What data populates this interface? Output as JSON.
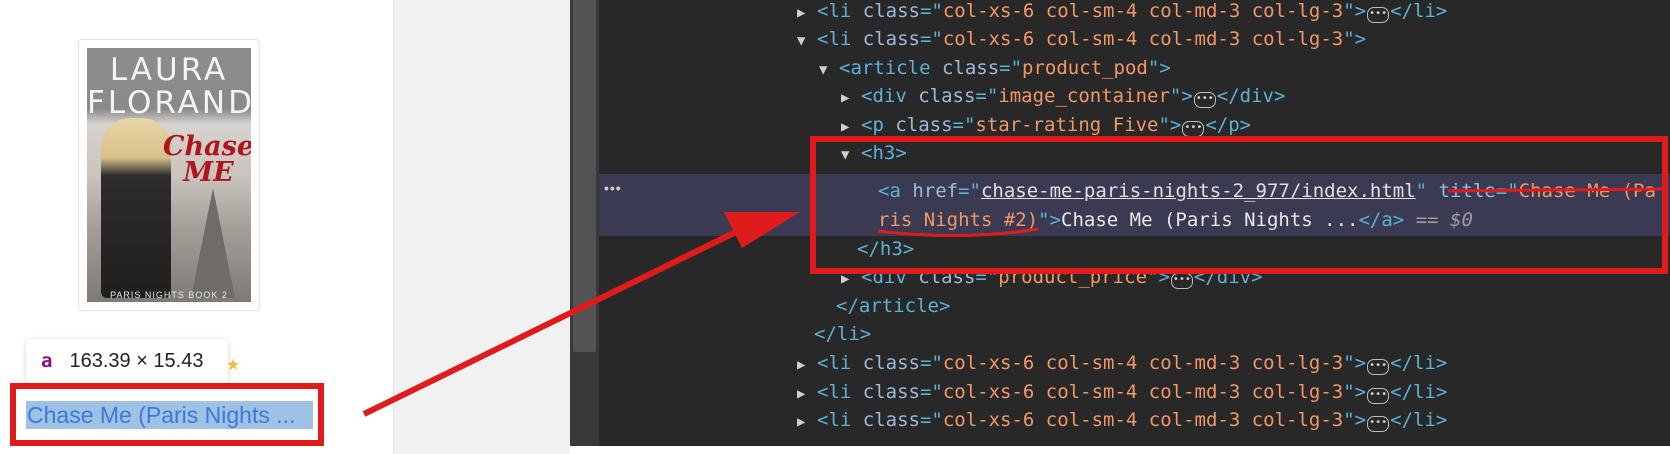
{
  "book": {
    "cover_author": "LAURA\nFLORAND",
    "cover_title": "Chase\nME",
    "cover_series": "PARIS NIGHTS BOOK 2",
    "link_text": "Chase Me (Paris Nights ..."
  },
  "tooltip": {
    "tag": "a",
    "dimensions": "163.39 × 15.43"
  },
  "devtools": {
    "gutter": "•••",
    "lines": {
      "li_cls": "col-xs-6 col-sm-4 col-md-3 col-lg-3",
      "article_cls": "product_pod",
      "div_image": "image_container",
      "p_rating": "star-rating Five",
      "href": "chase-me-paris-nights-2_977/index.html",
      "title_part1": "Chase Me (Pa",
      "title_part2": "ris Nights #2)",
      "link_text": "Chase Me (Paris Nights ...",
      "eq": "== $0",
      "div_price": "product_price"
    }
  },
  "colors": {
    "annotation_red": "#e01b1b",
    "devtools_bg": "#282828",
    "selected_row": "#3a3a52"
  }
}
